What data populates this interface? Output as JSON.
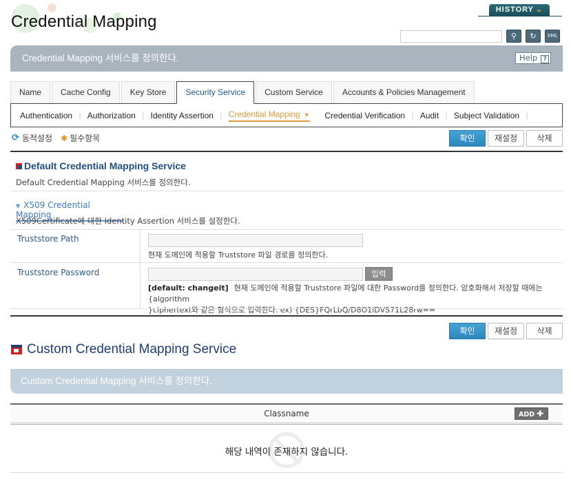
{
  "header": {
    "title": "Credential Mapping",
    "history_label": "HISTORY",
    "search_placeholder": "",
    "search_icon": "search-icon",
    "refresh_icon": "refresh-icon",
    "xml_icon": "xml-export-icon"
  },
  "banner": {
    "text": "Credential Mapping 서비스를 정의한다.",
    "help_label": "Help",
    "help_icon_glyph": "?"
  },
  "tabs": [
    {
      "label": "Name",
      "active": false
    },
    {
      "label": "Cache Config",
      "active": false
    },
    {
      "label": "Key Store",
      "active": false
    },
    {
      "label": "Security Service",
      "active": true
    },
    {
      "label": "Custom Service",
      "active": false
    },
    {
      "label": "Accounts & Policies Management",
      "active": false
    }
  ],
  "subnav": [
    {
      "label": "Authentication",
      "active": false
    },
    {
      "label": "Authorization",
      "active": false
    },
    {
      "label": "Identity Assertion",
      "active": false
    },
    {
      "label": "Credential Mapping",
      "active": true
    },
    {
      "label": "Credential Verification",
      "active": false
    },
    {
      "label": "Audit",
      "active": false
    },
    {
      "label": "Subject Validation",
      "active": false
    }
  ],
  "legend": {
    "dynamic_label": "동적설정",
    "required_label": "필수항목"
  },
  "actions": {
    "confirm": "확인",
    "reset": "재설정",
    "delete": "삭제"
  },
  "default_section": {
    "title": "Default Credential Mapping Service",
    "description": "Default Credential Mapping 서비스를 정의한다.",
    "subsection_title": "X509 Credential Mapping",
    "subsection_description": "X509Certificate에 대한 Identity Assertion 서비스를 설정한다.",
    "fields": [
      {
        "label": "Truststore Path",
        "value": "",
        "hint": "현재 도메인에 적용할 Truststore 파일 경로를 정의한다."
      },
      {
        "label": "Truststore Password",
        "value": "",
        "button": "입력",
        "default_text": "[default: changeit]",
        "hint_line1": "현재 도메인에 적용할 Truststore 파일에 대한 Password를 정의한다. 암호화해서 저장할 때에는 {algorithm",
        "hint_line2": "}ciphertext와 같은 형식으로 입력한다. ex) {DES}FQrLbQ/D8O1lDVS71L28rw=="
      }
    ]
  },
  "custom_section": {
    "title": "Custom Credential Mapping Service",
    "banner": "Custom Credential Mapping 서비스를 정의한다.",
    "column_header": "Classname",
    "add_label": "ADD",
    "empty_message": "해당 내역이 존재하지 않습니다."
  },
  "colors": {
    "primary_button": "#3592c8",
    "active_subnav": "#e09a3a",
    "active_tab_text": "#1a5a9a",
    "banner_bg": "#a9b4bf",
    "custom_banner_bg": "#c2d1de"
  }
}
